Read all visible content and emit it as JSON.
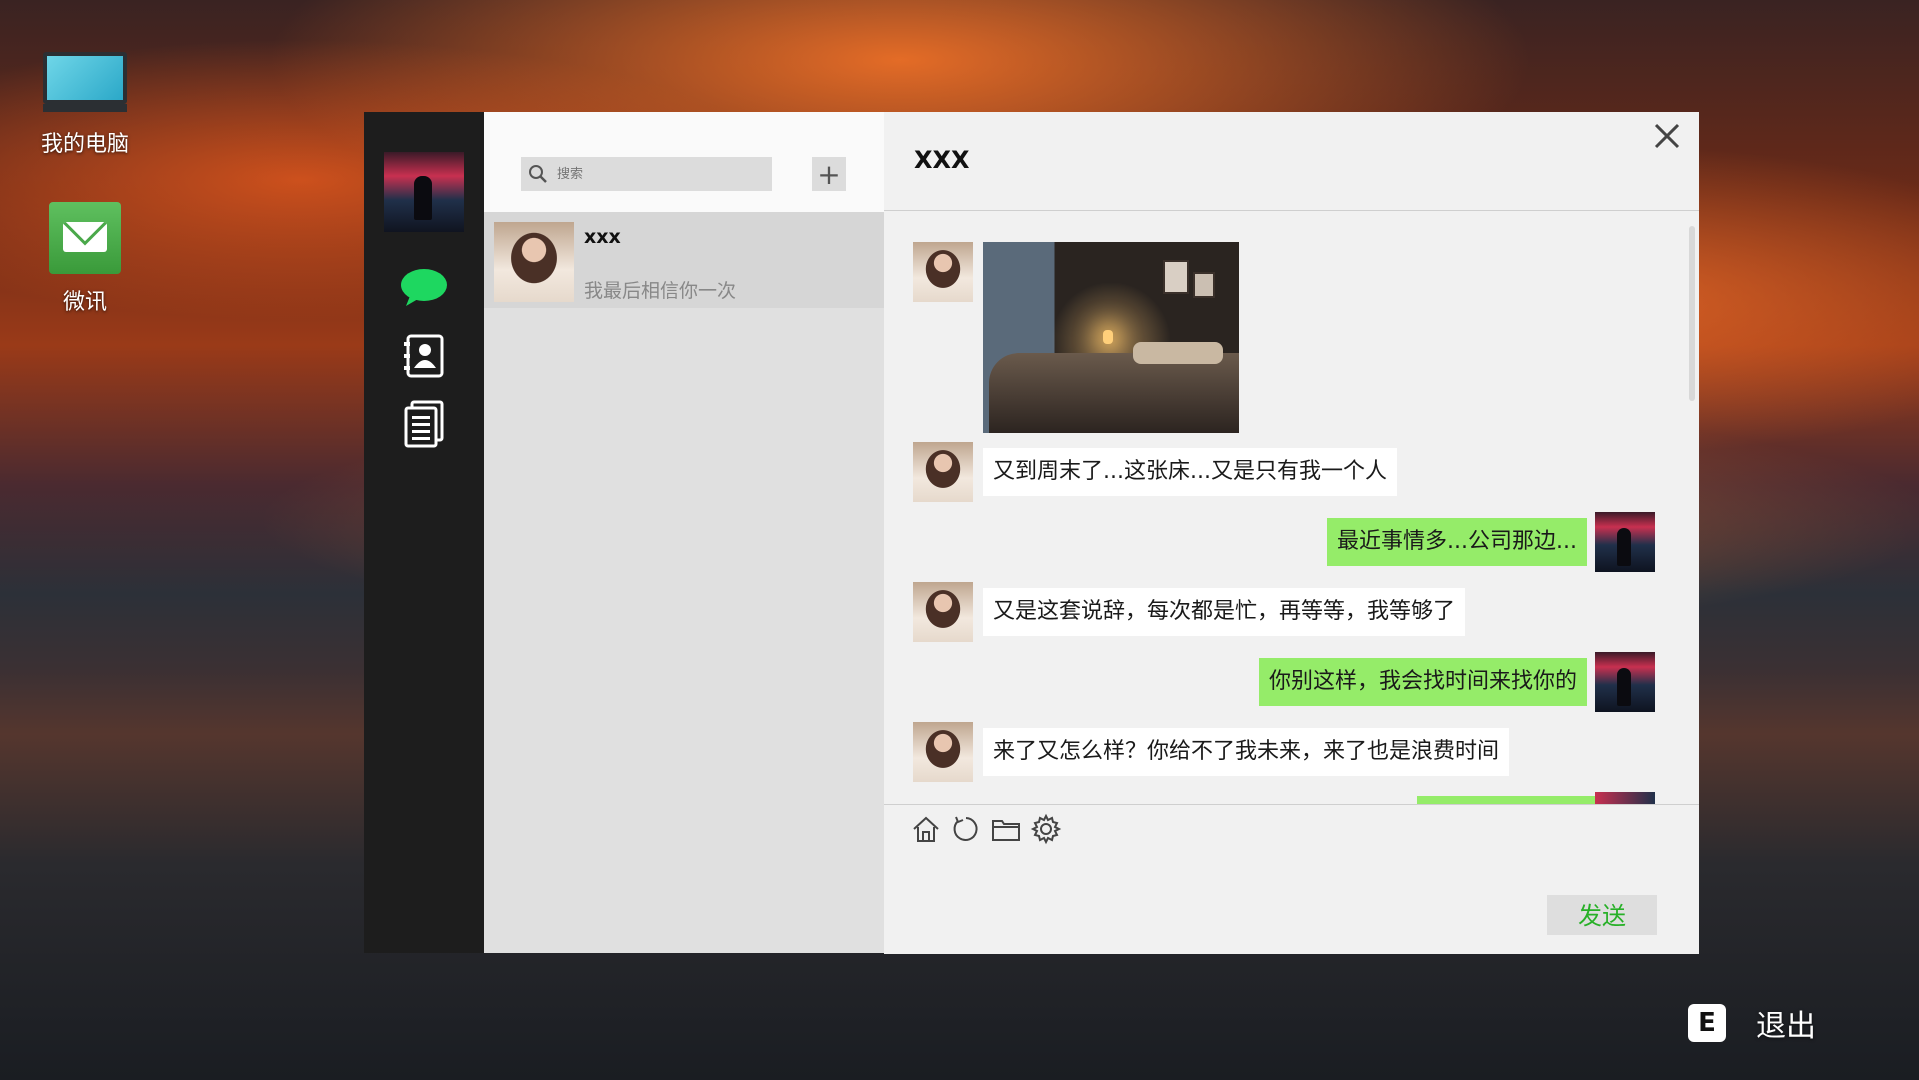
{
  "desktop": {
    "icons": [
      {
        "label": "我的电脑",
        "icon": "monitor-icon"
      },
      {
        "label": "微讯",
        "icon": "mail-icon"
      }
    ]
  },
  "app": {
    "rail": {
      "items": [
        {
          "name": "chat",
          "icon": "chat-bubble-icon",
          "color": "#1ed760"
        },
        {
          "name": "contacts",
          "icon": "contacts-icon"
        },
        {
          "name": "files",
          "icon": "document-icon"
        }
      ]
    },
    "search": {
      "placeholder": "搜索"
    },
    "add_label": "+",
    "contacts": [
      {
        "name": "xxx",
        "preview": "我最后相信你一次"
      }
    ],
    "chat": {
      "title": "XXX",
      "messages": [
        {
          "from": "them",
          "type": "image",
          "alt": "bedroom-photo"
        },
        {
          "from": "them",
          "type": "text",
          "text": "又到周末了...这张床...又是只有我一个人"
        },
        {
          "from": "me",
          "type": "text",
          "text": "最近事情多...公司那边..."
        },
        {
          "from": "them",
          "type": "text",
          "text": "又是这套说辞，每次都是忙，再等等，我等够了"
        },
        {
          "from": "me",
          "type": "text",
          "text": "你别这样，我会找时间来找你的"
        },
        {
          "from": "them",
          "type": "text",
          "text": "来了又怎么样？你给不了我未来，来了也是浪费时间"
        }
      ]
    },
    "composer": {
      "tools": [
        "home-icon",
        "refresh-icon",
        "folder-icon",
        "settings-icon"
      ],
      "send_label": "发送"
    }
  },
  "exit": {
    "key": "E",
    "label": "退出"
  },
  "colors": {
    "accent_green": "#95ec69",
    "send_text": "#27b027",
    "rail_bg": "#1d1d1d"
  }
}
